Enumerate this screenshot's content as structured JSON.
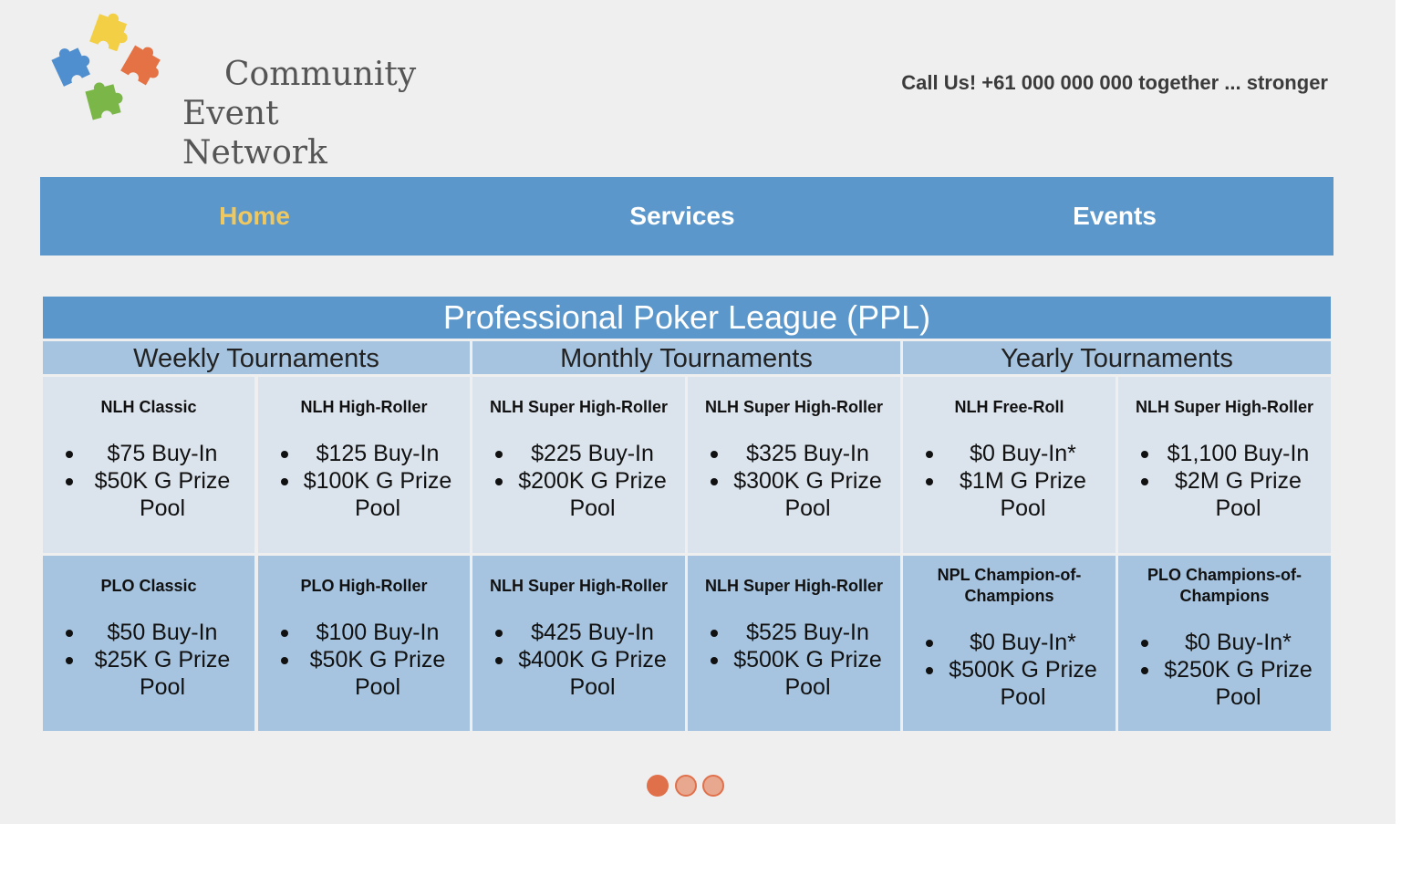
{
  "logo": {
    "line1": "Community",
    "line2": "Event Network",
    "colors": [
      "#f2cf45",
      "#4f8ecf",
      "#e47244",
      "#7ab648"
    ]
  },
  "header": {
    "callus": "Call Us! +61 000 000 000 together ... stronger"
  },
  "nav": {
    "items": [
      {
        "label": "Home",
        "active": true
      },
      {
        "label": "Services",
        "active": false
      },
      {
        "label": "Events",
        "active": false
      }
    ],
    "active_color": "#f0c860",
    "bg_color": "#5b97ca"
  },
  "league": {
    "title": "Professional Poker League (PPL)",
    "categories": [
      "Weekly Tournaments",
      "Monthly Tournaments",
      "Yearly Tournaments"
    ],
    "row1": [
      {
        "title": "NLH Classic",
        "buyin": "$75 Buy-In",
        "prize": "$50K G Prize Pool"
      },
      {
        "title": "NLH High-Roller",
        "buyin": "$125 Buy-In",
        "prize": "$100K G Prize Pool"
      },
      {
        "title": "NLH Super High-Roller",
        "buyin": "$225 Buy-In",
        "prize": "$200K G Prize Pool"
      },
      {
        "title": "NLH Super High-Roller",
        "buyin": "$325 Buy-In",
        "prize": "$300K G Prize Pool"
      },
      {
        "title": "NLH Free-Roll",
        "buyin": "$0 Buy-In*",
        "prize": "$1M G Prize Pool"
      },
      {
        "title": "NLH Super High-Roller",
        "buyin": "$1,100 Buy-In",
        "prize": "$2M G Prize Pool"
      }
    ],
    "row2": [
      {
        "title": "PLO Classic",
        "buyin": "$50 Buy-In",
        "prize": "$25K G Prize Pool"
      },
      {
        "title": "PLO High-Roller",
        "buyin": "$100 Buy-In",
        "prize": "$50K G Prize Pool"
      },
      {
        "title": "NLH Super High-Roller",
        "buyin": "$425 Buy-In",
        "prize": "$400K G Prize Pool"
      },
      {
        "title": "NLH Super High-Roller",
        "buyin": "$525 Buy-In",
        "prize": "$500K G Prize Pool"
      },
      {
        "title": "NPL Champion-of-Champions",
        "buyin": "$0 Buy-In*",
        "prize": "$500K G Prize Pool"
      },
      {
        "title": "PLO Champions-of-Champions",
        "buyin": "$0 Buy-In*",
        "prize": "$250K G Prize Pool"
      }
    ]
  },
  "carousel": {
    "pages": 3,
    "current": 1,
    "color": "#e0704a"
  }
}
